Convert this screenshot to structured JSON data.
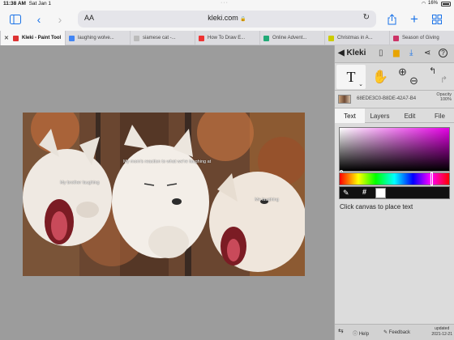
{
  "status": {
    "time": "11:38 AM",
    "date": "Sat Jan 1",
    "battery": "16%"
  },
  "browser": {
    "aa_label": "AA",
    "url": "kleki.com",
    "tabs": [
      {
        "label": "Kleki - Paint Tool",
        "active": true,
        "fav": "#d33"
      },
      {
        "label": "laughing wolve...",
        "active": false,
        "fav": "#4285f4"
      },
      {
        "label": "siamese cat -...",
        "active": false,
        "fav": "#bbb"
      },
      {
        "label": "How To Draw E...",
        "active": false,
        "fav": "#e33"
      },
      {
        "label": "Online Advent...",
        "active": false,
        "fav": "#2a7"
      },
      {
        "label": "Christmas in A...",
        "active": false,
        "fav": "#cc0"
      },
      {
        "label": "Season of Giving",
        "active": false,
        "fav": "#c36"
      }
    ]
  },
  "canvas": {
    "captions": {
      "left": "My brother laughing",
      "middle": "My mom's reaction to what we're laughing at",
      "right": "Me laughing"
    }
  },
  "panel": {
    "app_name": "Kleki",
    "layer_name": "68EDE3C0-B8DE-42A7-B4",
    "opacity_label": "Opacity",
    "opacity_value": "100%",
    "tabs": [
      "Text",
      "Layers",
      "Edit",
      "File"
    ],
    "active_tab": "Text",
    "hash": "#",
    "hint": "Click canvas to place text",
    "footer": {
      "help": "Help",
      "feedback": "Feedback",
      "updated_label": "updated",
      "updated_date": "2021-12-21"
    }
  },
  "colors": {
    "accent": "#1a73e8",
    "primary_color": "#ffffff"
  }
}
